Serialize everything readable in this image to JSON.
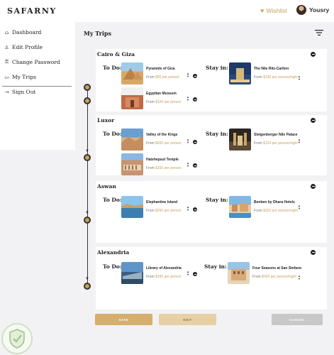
{
  "header": {
    "brand": "SAFARNY",
    "wishlist_label": "Wishlist",
    "user_name": "Yousry"
  },
  "sidebar": {
    "items": [
      {
        "label": "Dashboard",
        "icon": "home-icon"
      },
      {
        "label": "Edit Profile",
        "icon": "user-icon"
      },
      {
        "label": "Change Password",
        "icon": "lock-icon"
      },
      {
        "label": "My Trips",
        "icon": "trips-icon",
        "active": true
      },
      {
        "label": "Sign Out",
        "icon": "sign-out-icon"
      }
    ]
  },
  "main": {
    "title": "My Trips"
  },
  "labels": {
    "todo": "To Do:",
    "stay": "Stay in:"
  },
  "cities": [
    {
      "name": "Cairo & Giza",
      "todo": [
        {
          "name": "Pyramids of Giza",
          "price_prefix": "From ",
          "price": "$60 per person"
        },
        {
          "name": "Egyptian Museum",
          "price_prefix": "From ",
          "price": "$100 per person"
        }
      ],
      "stay": {
        "name": "The Nile Ritz-Carlton",
        "price_prefix": "From ",
        "price": "$100 per person/night"
      }
    },
    {
      "name": "Luxor",
      "todo": [
        {
          "name": "Valley of the Kings",
          "price_prefix": "From ",
          "price": "$200 per person"
        },
        {
          "name": "Hatshepsut Temple",
          "price_prefix": "From ",
          "price": "$150 per person"
        }
      ],
      "stay": {
        "name": "Steigenberger Nile Palace",
        "price_prefix": "From ",
        "price": "$124 per person/night"
      }
    },
    {
      "name": "Aswan",
      "todo": [
        {
          "name": "Elephantine Island",
          "price_prefix": "From ",
          "price": "$250 per person"
        }
      ],
      "stay": {
        "name": "Benben by Dhara Hotels",
        "price_prefix": "From ",
        "price": "$323 per person/night"
      }
    },
    {
      "name": "Alexandria",
      "todo": [
        {
          "name": "Library of Alexandria",
          "price_prefix": "From ",
          "price": "$150 per person"
        }
      ],
      "stay": {
        "name": "Four Seasons at San Stefano",
        "price_prefix": "From ",
        "price": "$343 per person/night"
      }
    }
  ],
  "buttons": {
    "save": "SAVE",
    "edit": "EDIT",
    "cancel": "CANCEL"
  },
  "colors": {
    "accent": "#c7a15a",
    "save": "#d6ae6e",
    "edit": "#e8cfa6",
    "cancel": "#c8c8c8",
    "background": "#f2f2f4"
  }
}
